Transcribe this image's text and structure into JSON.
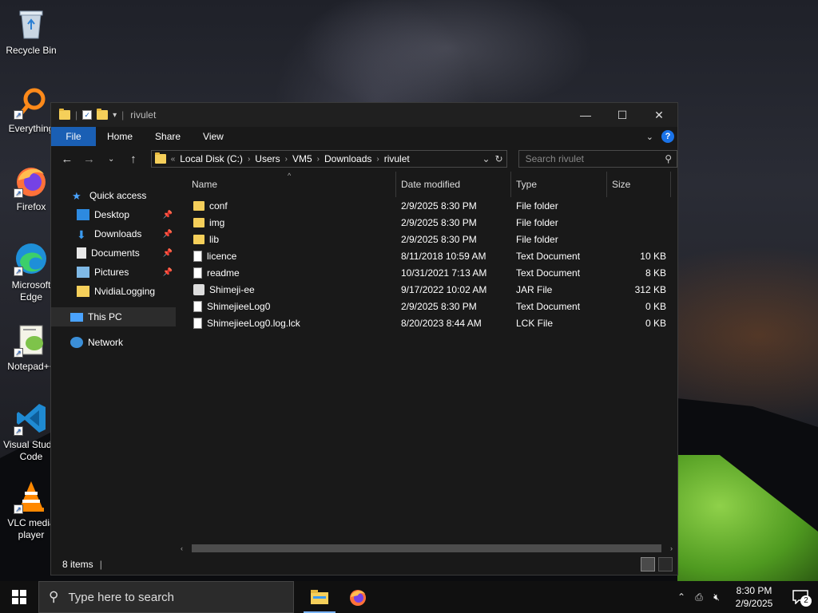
{
  "desktop": {
    "icons": [
      {
        "label": "Recycle Bin"
      },
      {
        "label": "Everything"
      },
      {
        "label": "Firefox"
      },
      {
        "label": "Microsoft Edge"
      },
      {
        "label": "Notepad++"
      },
      {
        "label": "Visual Studio Code"
      },
      {
        "label": "VLC media player"
      }
    ]
  },
  "window": {
    "title": "rivulet",
    "ribbon_tabs": [
      "File",
      "Home",
      "Share",
      "View"
    ],
    "help_label": "?",
    "address": {
      "crumbs": [
        "Local Disk (C:)",
        "Users",
        "VM5",
        "Downloads",
        "rivulet"
      ]
    },
    "search": {
      "placeholder": "Search rivulet"
    },
    "nav": {
      "quick_access": "Quick access",
      "items": [
        "Desktop",
        "Downloads",
        "Documents",
        "Pictures",
        "NvidiaLogging"
      ],
      "this_pc": "This PC",
      "network": "Network"
    },
    "columns": [
      "Name",
      "Date modified",
      "Type",
      "Size"
    ],
    "files": [
      {
        "name": "conf",
        "date": "2/9/2025 8:30 PM",
        "type": "File folder",
        "size": "",
        "icon": "folder"
      },
      {
        "name": "img",
        "date": "2/9/2025 8:30 PM",
        "type": "File folder",
        "size": "",
        "icon": "folder"
      },
      {
        "name": "lib",
        "date": "2/9/2025 8:30 PM",
        "type": "File folder",
        "size": "",
        "icon": "folder"
      },
      {
        "name": "licence",
        "date": "8/11/2018 10:59 AM",
        "type": "Text Document",
        "size": "10 KB",
        "icon": "doc"
      },
      {
        "name": "readme",
        "date": "10/31/2021 7:13 AM",
        "type": "Text Document",
        "size": "8 KB",
        "icon": "doc"
      },
      {
        "name": "Shimeji-ee",
        "date": "9/17/2022 10:02 AM",
        "type": "JAR File",
        "size": "312 KB",
        "icon": "jar"
      },
      {
        "name": "ShimejieeLog0",
        "date": "2/9/2025 8:30 PM",
        "type": "Text Document",
        "size": "0 KB",
        "icon": "doc"
      },
      {
        "name": "ShimejieeLog0.log.lck",
        "date": "8/20/2023 8:44 AM",
        "type": "LCK File",
        "size": "0 KB",
        "icon": "blank"
      }
    ],
    "status": {
      "count": "8 items"
    }
  },
  "taskbar": {
    "search_placeholder": "Type here to search",
    "time": "8:30 PM",
    "date": "2/9/2025",
    "notification_count": "2"
  },
  "colors": {
    "accent": "#1a5fb4",
    "folder": "#f5cf5a",
    "window_bg": "#191919"
  }
}
